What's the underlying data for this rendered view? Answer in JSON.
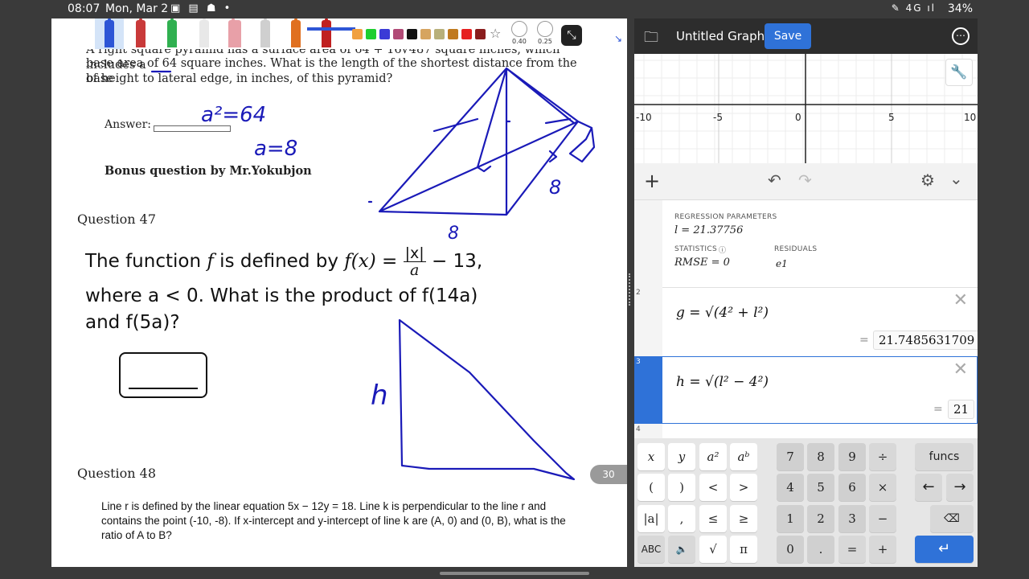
{
  "status": {
    "time": "08:07",
    "date": "Mon, Mar 2",
    "battery": "34%",
    "signal": "4G"
  },
  "notes": {
    "toolbar": {
      "thickness_1": "0.40",
      "thickness_2": "0.25",
      "swatches": [
        "#f0a040",
        "#1fce2f",
        "#3b3bd6",
        "#b14a76",
        "#111111",
        "#d6a460",
        "#b8b07a",
        "#c07a1f",
        "#e62020",
        "#8a1d1d"
      ]
    },
    "problem_text_line0": "A right square pyramid has a surface area of 64 + 16√487 square inches, which includes a",
    "problem_text_line1": "base area of 64 square inches. What is the length of the shortest distance from the base",
    "problem_text_line2": "of height to lateral edge, in inches, of this pyramid?",
    "answer_label": "Answer:",
    "bonus": "Bonus question by Mr.Yokubjon",
    "q47_title": "Question 47",
    "q47_line1_pre": "The function ",
    "q47_line1_f": "f",
    "q47_line1_mid": " is defined by ",
    "q47_line1_fx": "f(x) = ",
    "q47_line1_num": "|x|",
    "q47_line1_den": "a",
    "q47_line1_end": " − 13,",
    "q47_line2": "where a < 0. What is the product of f(14a)",
    "q47_line3": "and f(5a)?",
    "q48_title": "Question 48",
    "q48_text": "Line r is defined by the linear equation 5x − 12y = 18. Line k is perpendicular to the line r and contains the point (-10, -8). If x-intercept and y-intercept of line k are (A, 0) and (0, B), what is the ratio of A to B?",
    "page_number": "30",
    "handwriting": {
      "eq1": "a²=64",
      "eq2": "a=8",
      "side": "8",
      "base": "8",
      "h": "h"
    }
  },
  "desmos": {
    "title": "Untitled Graph",
    "save_label": "Save",
    "axis_ticks": [
      "-10",
      "-5",
      "0",
      "5",
      "10"
    ],
    "regression_label": "REGRESSION PARAMETERS",
    "regression_value": "l = 21.37756",
    "statistics_label": "STATISTICS",
    "rmse_value": "RMSE = 0",
    "residuals_label": "RESIDUALS",
    "residuals_value": "e1",
    "expr2_num": "2",
    "expr2": "g = √(4² + l²)",
    "expr2_result": "21.7485631709",
    "expr3_num": "3",
    "expr3": "h = √(l² − 4²)",
    "expr3_result": "21",
    "expr4_num": "4",
    "keys": {
      "row1": [
        "x",
        "y",
        "a²",
        "aᵇ",
        "7",
        "8",
        "9",
        "÷",
        "funcs"
      ],
      "row2": [
        "(",
        ")",
        "<",
        ">",
        "4",
        "5",
        "6",
        "×",
        "←",
        "→"
      ],
      "row3": [
        "|a|",
        ",",
        "≤",
        "≥",
        "1",
        "2",
        "3",
        "−",
        "⌫"
      ],
      "row4": [
        "ABC",
        "🔈",
        "√",
        "π",
        "0",
        ".",
        "=",
        "+",
        "↵"
      ]
    }
  }
}
